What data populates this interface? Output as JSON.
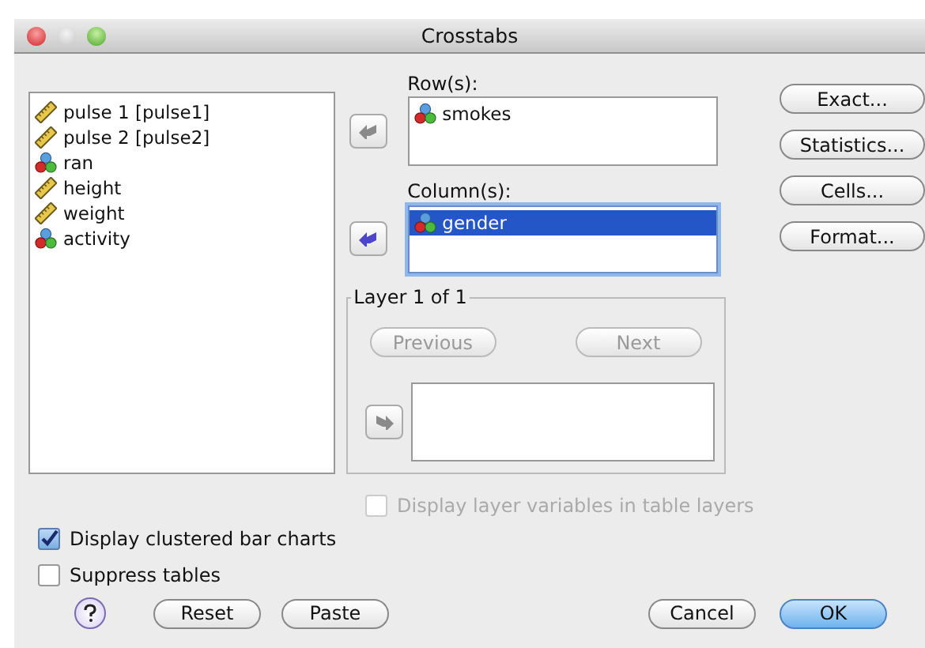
{
  "window": {
    "title": "Crosstabs"
  },
  "variables": [
    {
      "label": "pulse 1 [pulse1]",
      "kind": "scale",
      "selected": false
    },
    {
      "label": "pulse 2 [pulse2]",
      "kind": "scale",
      "selected": false
    },
    {
      "label": "ran",
      "kind": "nominal",
      "selected": false
    },
    {
      "label": "height",
      "kind": "scale",
      "selected": false
    },
    {
      "label": "weight",
      "kind": "scale",
      "selected": false
    },
    {
      "label": "activity",
      "kind": "nominal",
      "selected": false
    }
  ],
  "rows": {
    "label": "Row(s):",
    "arrow_active": false,
    "items": [
      {
        "label": "smokes",
        "kind": "nominal",
        "selected": false
      }
    ]
  },
  "columns": {
    "label": "Column(s):",
    "arrow_active": true,
    "items": [
      {
        "label": "gender",
        "kind": "nominal",
        "selected": true
      }
    ]
  },
  "layer": {
    "title": "Layer 1 of 1",
    "previous": {
      "label": "Previous",
      "disabled": true
    },
    "next": {
      "label": "Next",
      "disabled": true
    },
    "arrow_active": false
  },
  "side_buttons": [
    "Exact...",
    "Statistics...",
    "Cells...",
    "Format..."
  ],
  "checkboxes": [
    {
      "label": "Display layer variables in table layers",
      "checked": false,
      "disabled": true
    },
    {
      "label": "Display clustered bar charts",
      "checked": true,
      "disabled": false
    },
    {
      "label": "Suppress tables",
      "checked": false,
      "disabled": false
    }
  ],
  "bottom_buttons": [
    {
      "label": "Reset",
      "default": false
    },
    {
      "label": "Paste",
      "default": false
    },
    {
      "label": "Cancel",
      "default": false
    },
    {
      "label": "OK",
      "default": true
    }
  ]
}
